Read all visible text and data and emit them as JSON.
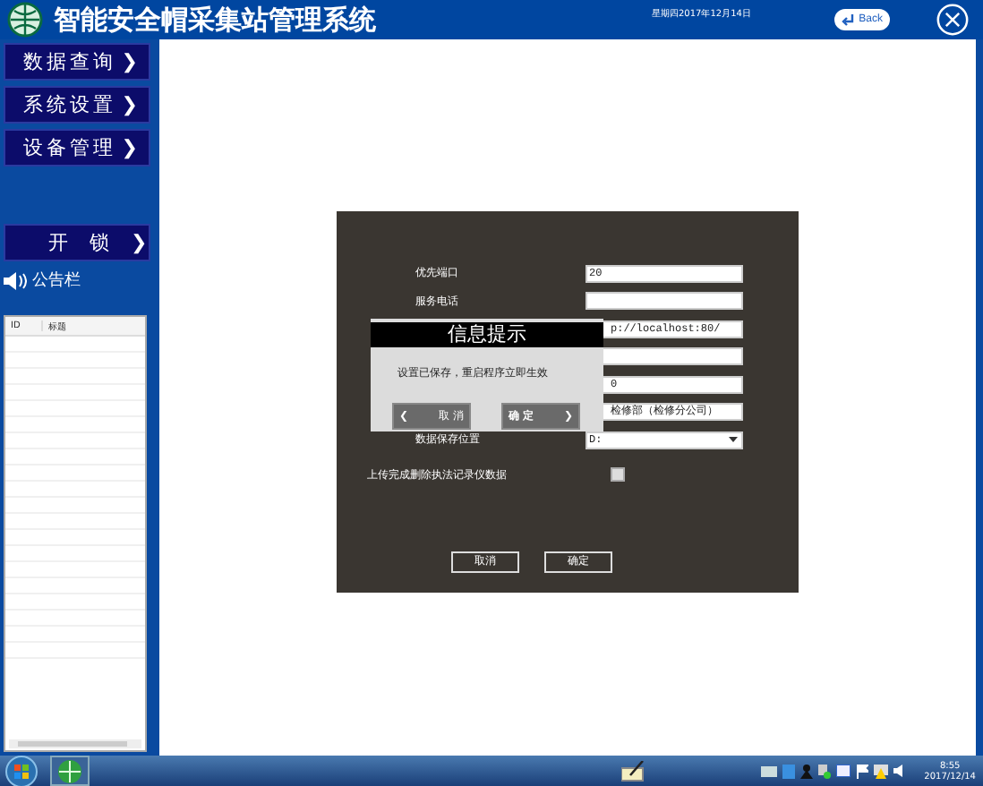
{
  "header": {
    "title": "智能安全帽采集站管理系统",
    "date": "星期四2017年12月14日",
    "back_button": "Back"
  },
  "sidebar": {
    "menu": [
      {
        "label": "数据查询",
        "arrow": "❯"
      },
      {
        "label": "系统设置",
        "arrow": "❯"
      },
      {
        "label": "设备管理",
        "arrow": "❯"
      }
    ],
    "unlock_button": {
      "label": "开锁",
      "arrow": "❯"
    },
    "notice_label": "公告栏",
    "notice_table": {
      "columns": [
        "ID",
        "标题"
      ]
    }
  },
  "settings": {
    "fields": [
      {
        "kind": "text",
        "label": "优先端口",
        "value": "20"
      },
      {
        "kind": "text",
        "label": "服务电话"
      },
      {
        "kind": "text",
        "value": "p://localhost:80/"
      },
      {
        "kind": "text"
      },
      {
        "kind": "text",
        "value": "0"
      },
      {
        "kind": "text",
        "value": "检修部（检修分公司）"
      }
    ],
    "storage": {
      "label": "数据保存位置",
      "value": "D:"
    },
    "delete_after_upload": {
      "label": "上传完成删除执法记录仪数据",
      "checked": false
    },
    "buttons": [
      "取消",
      "确定"
    ]
  },
  "dialog": {
    "title": "信息提示",
    "message": "设置已保存，重启程序立即生效",
    "cancel": {
      "arrow": "❮",
      "label": "取 消"
    },
    "ok": {
      "label": "确 定",
      "arrow": "❯"
    }
  },
  "taskbar": {
    "time": "8:55",
    "date": "2017/12/14"
  }
}
